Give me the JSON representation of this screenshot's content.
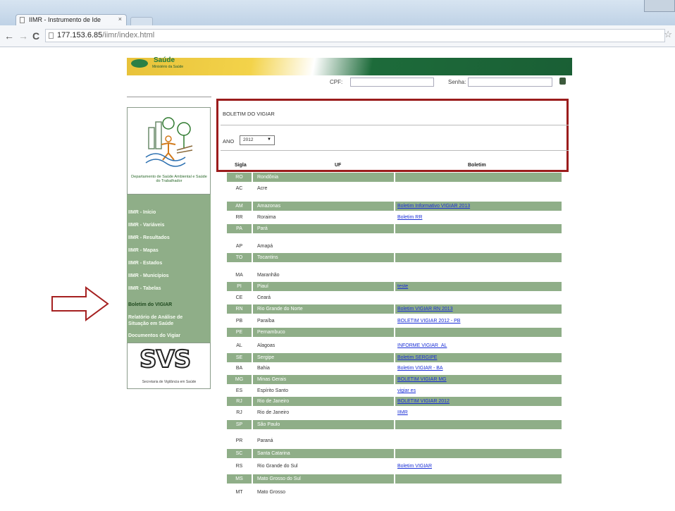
{
  "browser": {
    "tab_title": "IIMR - Instrumento de Ide",
    "tab_close": "×",
    "url_host": "177.153.6.85",
    "url_path": "/iimr/index.html",
    "back": "←",
    "forward": "→",
    "reload": "C",
    "star": "☆"
  },
  "banner": {
    "logo_main": "Saúde",
    "logo_sub": "Ministério da Saúde"
  },
  "login": {
    "cpf_label": "CPF:",
    "senha_label": "Senha:"
  },
  "sidebar": {
    "dept_text": "Departamento de Saúde Ambiental e Saúde do Trabalhador",
    "menu": [
      {
        "label": "IIMR - Início"
      },
      {
        "label": "IIMR - Variáveis"
      },
      {
        "label": "IIMR - Resultados"
      },
      {
        "label": "IIMR - Mapas"
      },
      {
        "label": "IIMR - Estados"
      },
      {
        "label": "IIMR - Municípios"
      },
      {
        "label": "IIMR - Tabelas"
      },
      {
        "label": "Boletim do VIGIAR"
      },
      {
        "label": "Relatório de Análise de"
      },
      {
        "label": "Situação em Saúde"
      },
      {
        "label": "Documentos do Vigiar"
      }
    ],
    "svs_logo": "SVS",
    "svs_text": "Secretaria de Vigilância em Saúde"
  },
  "main": {
    "title": "BOLETIM DO VIGIAR",
    "ano_label": "ANO",
    "ano_value": "2012",
    "col_sigla": "Sigla",
    "col_uf": "UF",
    "col_boletim": "Boletim"
  },
  "rows": [
    {
      "sigla": "RO",
      "uf": "Rondônia",
      "boletim": ""
    },
    {
      "sigla": "AC",
      "uf": "Acre",
      "boletim": ""
    },
    {
      "sigla": "AM",
      "uf": "Amazonas",
      "boletim": "Boletim Informativo VIGIAR 2013"
    },
    {
      "sigla": "RR",
      "uf": "Roraima",
      "boletim": "Boletim RR"
    },
    {
      "sigla": "PA",
      "uf": "Pará",
      "boletim": ""
    },
    {
      "sigla": "AP",
      "uf": "Amapá",
      "boletim": ""
    },
    {
      "sigla": "TO",
      "uf": "Tocantins",
      "boletim": ""
    },
    {
      "sigla": "MA",
      "uf": "Maranhão",
      "boletim": ""
    },
    {
      "sigla": "PI",
      "uf": "Piauí",
      "boletim": "teste"
    },
    {
      "sigla": "CE",
      "uf": "Ceará",
      "boletim": ""
    },
    {
      "sigla": "RN",
      "uf": "Rio Grande do Norte",
      "boletim": "Boletim VIGIAR RN 2013"
    },
    {
      "sigla": "PB",
      "uf": "Paraíba",
      "boletim": "BOLETIM VIGIAR 2012 - PB"
    },
    {
      "sigla": "PE",
      "uf": "Pernambuco",
      "boletim": ""
    },
    {
      "sigla": "AL",
      "uf": "Alagoas",
      "boletim": "INFORME VIGIAR_AL"
    },
    {
      "sigla": "SE",
      "uf": "Sergipe",
      "boletim": "Boletim SERGIPE"
    },
    {
      "sigla": "BA",
      "uf": "Bahia",
      "boletim": "Boletim VIGIAR - BA"
    },
    {
      "sigla": "MG",
      "uf": "Minas Gerais",
      "boletim": "BOLETIM VIGIAR MG"
    },
    {
      "sigla": "ES",
      "uf": "Espírito Santo",
      "boletim": "vigiar es"
    },
    {
      "sigla": "RJ",
      "uf": "Rio de Janeiro",
      "boletim": "BOLETIM VIGIAR 2012"
    },
    {
      "sigla": "RJ",
      "uf": "Rio de Janeiro",
      "boletim": "IIMR"
    },
    {
      "sigla": "SP",
      "uf": "São Paulo",
      "boletim": ""
    },
    {
      "sigla": "PR",
      "uf": "Paraná",
      "boletim": ""
    },
    {
      "sigla": "SC",
      "uf": "Santa Catarina",
      "boletim": ""
    },
    {
      "sigla": "RS",
      "uf": "Rio Grande do Sul",
      "boletim": "Boletim VIGIAR"
    },
    {
      "sigla": "MS",
      "uf": "Mato Grosso do Sul",
      "boletim": ""
    },
    {
      "sigla": "MT",
      "uf": "Mato Grosso",
      "boletim": ""
    }
  ]
}
